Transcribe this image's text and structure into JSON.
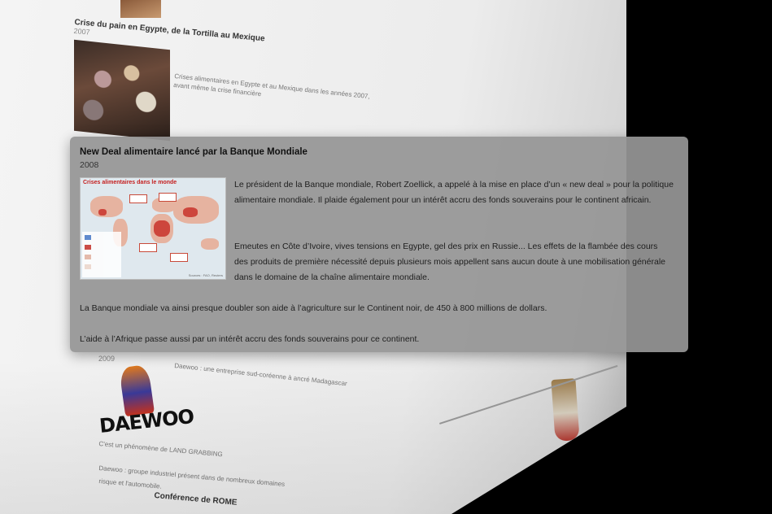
{
  "background": {
    "entry1": {
      "title": "Crise du pain en Egypte, de la Tortilla au Mexique",
      "year": "2007",
      "text": "Crises alimentaires en Egypte et au Mexique dans les années 2007, avant même la crise financière"
    },
    "entry2": {
      "year": "2009",
      "text": "Daewoo : une entreprise sud-coréenne à ancré Madagascar",
      "logo_text": "DAEWOO",
      "note": "C'est un phénomène de LAND GRABBING",
      "footer": "Daewoo : groupe industriel présent dans de nombreux domaines",
      "sub": "risque et l'automobile.",
      "conference_title": "Conférence de ROME"
    }
  },
  "card": {
    "title": "New Deal alimentaire lancé par la Banque Mondiale",
    "year": "2008",
    "paragraph1": "Le président de la Banque mondiale, Robert Zoellick, a appelé à la mise en place d’un « new deal » pour la politique alimentaire mondiale. Il plaide également pour un intérêt accru des fonds souverains pour le continent africain.",
    "paragraph2": "Emeutes en Côte d’Ivoire, vives tensions en Egypte, gel des prix en Russie... Les effets de la flambée des cours des produits de première nécessité depuis plusieurs mois appellent sans aucun doute à une mobilisation générale dans le domaine de la chaîne alimentaire mondiale.",
    "paragraph3": "La Banque mondiale va ainsi presque doubler son aide à l’agriculture sur le Continent noir, de 450 à 800 millions de dollars.",
    "paragraph4": "L’aide à l’Afrique passe aussi par un intérêt accru des fonds souverains pour ce continent.",
    "map": {
      "title": "Crises alimentaires dans le monde",
      "source": "Sources : FAO, Reuters"
    }
  },
  "colors": {
    "card_bg": "#969696",
    "map_red": "#c8322a",
    "map_land": "#e6b3a0"
  }
}
